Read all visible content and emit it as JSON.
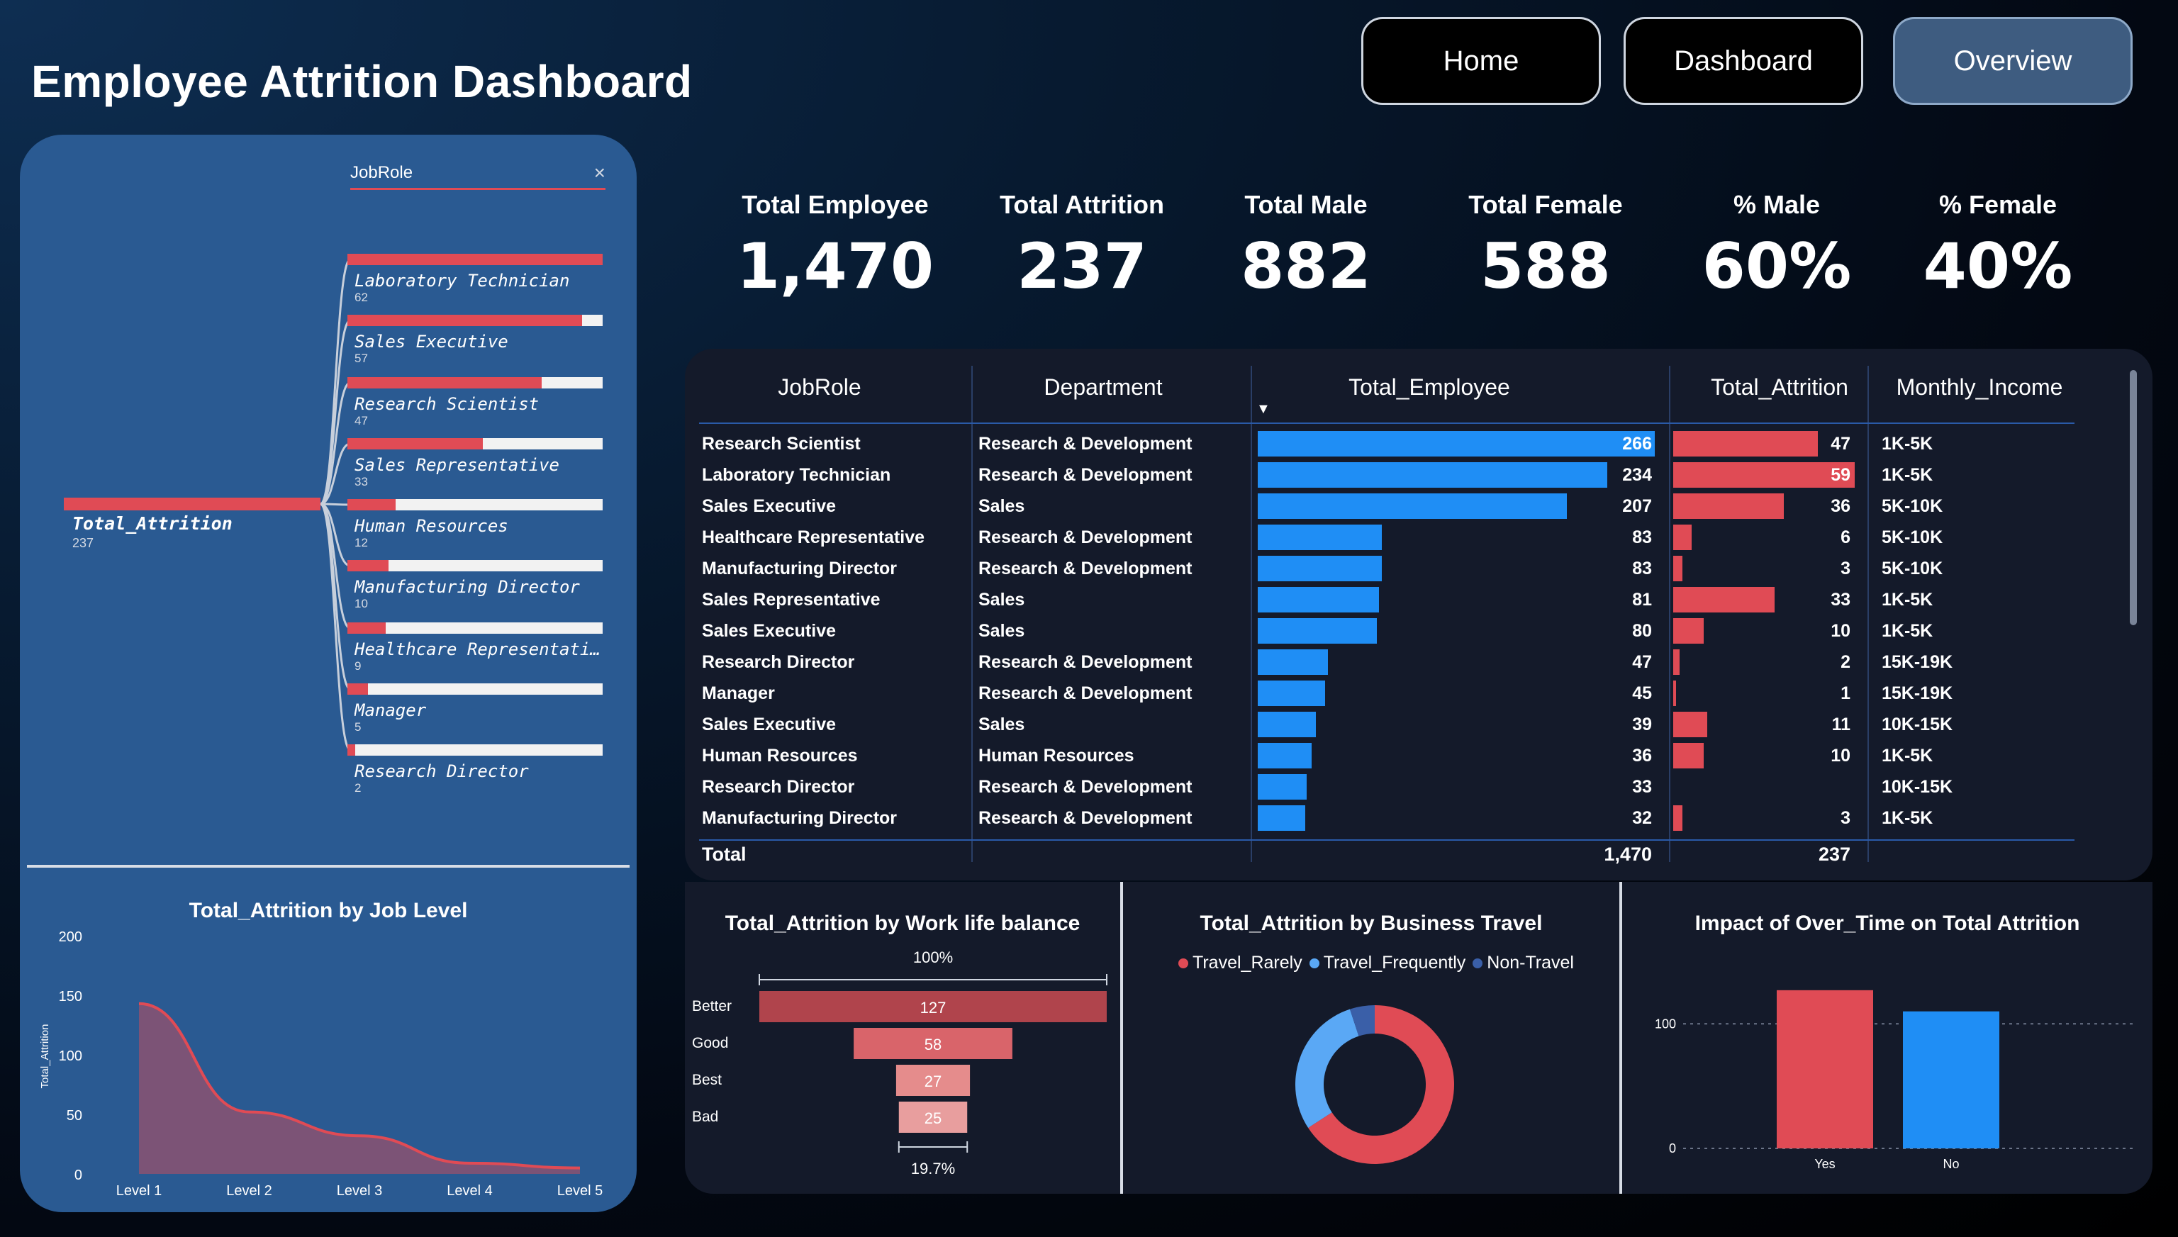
{
  "title": "Employee Attrition Dashboard",
  "nav": {
    "home": "Home",
    "dashboard": "Dashboard",
    "overview": "Overview"
  },
  "kpis": [
    {
      "label": "Total Employee",
      "value": "1,470"
    },
    {
      "label": "Total Attrition",
      "value": "237"
    },
    {
      "label": "Total Male",
      "value": "882"
    },
    {
      "label": "Total Female",
      "value": "588"
    },
    {
      "label": "% Male",
      "value": "60%"
    },
    {
      "label": "% Female",
      "value": "40%"
    }
  ],
  "decomp_tree": {
    "header": "JobRole",
    "close_icon": "×",
    "root": {
      "label": "Total_Attrition",
      "value": "237"
    },
    "nodes": [
      {
        "label": "Laboratory Technician",
        "value": "62",
        "share": 1.0
      },
      {
        "label": "Sales Executive",
        "value": "57",
        "share": 0.92
      },
      {
        "label": "Research Scientist",
        "value": "47",
        "share": 0.76
      },
      {
        "label": "Sales Representative",
        "value": "33",
        "share": 0.53
      },
      {
        "label": "Human Resources",
        "value": "12",
        "share": 0.19
      },
      {
        "label": "Manufacturing Director",
        "value": "10",
        "share": 0.16
      },
      {
        "label": "Healthcare Representati...",
        "value": "9",
        "share": 0.15
      },
      {
        "label": "Manager",
        "value": "5",
        "share": 0.08
      },
      {
        "label": "Research Director",
        "value": "2",
        "share": 0.03
      }
    ]
  },
  "table": {
    "headers": [
      "JobRole",
      "Department",
      "Total_Employee",
      "Total_Attrition",
      "Monthly_Income"
    ],
    "sort_icon": "▼",
    "rows": [
      {
        "role": "Research Scientist",
        "dept": "Research & Development",
        "emp": 266,
        "att": 47,
        "income": "1K-5K"
      },
      {
        "role": "Laboratory Technician",
        "dept": "Research & Development",
        "emp": 234,
        "att": 59,
        "income": "1K-5K"
      },
      {
        "role": "Sales Executive",
        "dept": "Sales",
        "emp": 207,
        "att": 36,
        "income": "5K-10K"
      },
      {
        "role": "Healthcare Representative",
        "dept": "Research & Development",
        "emp": 83,
        "att": 6,
        "income": "5K-10K"
      },
      {
        "role": "Manufacturing Director",
        "dept": "Research & Development",
        "emp": 83,
        "att": 3,
        "income": "5K-10K"
      },
      {
        "role": "Sales Representative",
        "dept": "Sales",
        "emp": 81,
        "att": 33,
        "income": "1K-5K"
      },
      {
        "role": "Sales Executive",
        "dept": "Sales",
        "emp": 80,
        "att": 10,
        "income": "1K-5K"
      },
      {
        "role": "Research Director",
        "dept": "Research & Development",
        "emp": 47,
        "att": 2,
        "income": "15K-19K"
      },
      {
        "role": "Manager",
        "dept": "Research & Development",
        "emp": 45,
        "att": 1,
        "income": "15K-19K"
      },
      {
        "role": "Sales Executive",
        "dept": "Sales",
        "emp": 39,
        "att": 11,
        "income": "10K-15K"
      },
      {
        "role": "Human Resources",
        "dept": "Human Resources",
        "emp": 36,
        "att": 10,
        "income": "1K-5K"
      },
      {
        "role": "Research Director",
        "dept": "Research & Development",
        "emp": 33,
        "att": null,
        "income": "10K-15K"
      },
      {
        "role": "Manufacturing Director",
        "dept": "Research & Development",
        "emp": 32,
        "att": 3,
        "income": "1K-5K"
      }
    ],
    "total_label": "Total",
    "total_emp": "1,470",
    "total_att": "237"
  },
  "chart_data": [
    {
      "type": "area",
      "title": "Total_Attrition by Job Level",
      "ylabel": "Total_Attrition",
      "xlabel": "",
      "categories": [
        "Level 1",
        "Level 2",
        "Level 3",
        "Level 4",
        "Level 5"
      ],
      "values": [
        143,
        52,
        32,
        9,
        5
      ],
      "yticks": [
        "0",
        "50",
        "100",
        "150",
        "200"
      ],
      "ylim": [
        0,
        200
      ],
      "color": "#e04b55"
    },
    {
      "type": "bar",
      "orientation": "funnel",
      "title": "Total_Attrition by Work life balance",
      "categories": [
        "Better",
        "Good",
        "Best",
        "Bad"
      ],
      "values": [
        127,
        58,
        27,
        25
      ],
      "top_label": "100%",
      "bottom_label": "19.7%",
      "colors": [
        "#b0444c",
        "#d9646a",
        "#e58c8c",
        "#e89e9e"
      ]
    },
    {
      "type": "pie",
      "title": "Total_Attrition by Business Travel",
      "categories": [
        "Travel_Rarely",
        "Travel_Frequently",
        "Non-Travel"
      ],
      "values": [
        156,
        69,
        12
      ],
      "colors": [
        "#e04b55",
        "#5aa8f5",
        "#3a5fa8"
      ],
      "donut": true
    },
    {
      "type": "bar",
      "title": "Impact of Over_Time on Total Attrition",
      "categories": [
        "Yes",
        "No"
      ],
      "values": [
        127,
        110
      ],
      "yticks": [
        "0",
        "100"
      ],
      "ylim": [
        0,
        140
      ],
      "colors": [
        "#e04b55",
        "#1f8ef5"
      ]
    }
  ]
}
